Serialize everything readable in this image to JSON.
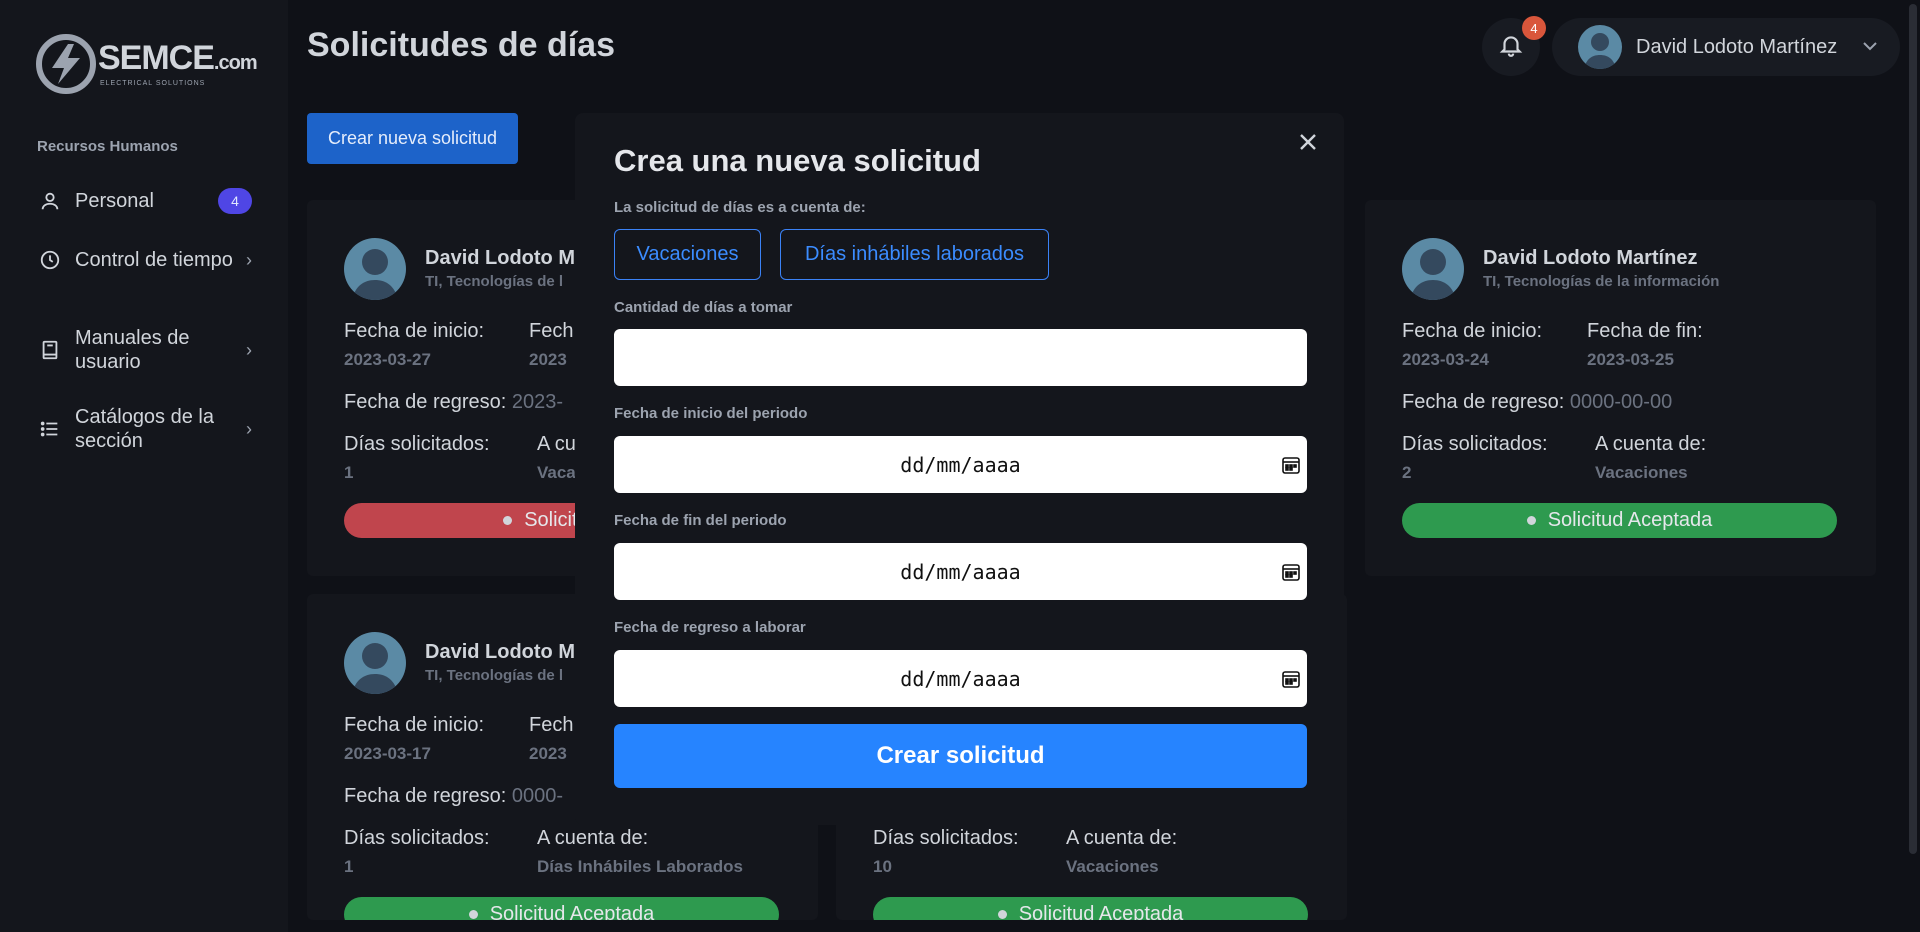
{
  "sidebar": {
    "logo": {
      "name": "SEMCE",
      "suffix": ".com",
      "tagline": "ELECTRICAL SOLUTIONS"
    },
    "section": "Recursos Humanos",
    "items": [
      {
        "label": "Personal",
        "icon": "user-icon",
        "badge": "4"
      },
      {
        "label": "Control de tiempo",
        "icon": "clock-icon"
      },
      {
        "label": "Manuales de usuario",
        "icon": "book-icon"
      },
      {
        "label": "Catálogos de la sección",
        "icon": "list-icon"
      }
    ]
  },
  "header": {
    "title": "Solicitudes de días",
    "notifications": "4",
    "user_name": "David Lodoto Martínez"
  },
  "new_request_label": "Crear nueva solicitud",
  "labels": {
    "start": "Fecha de inicio:",
    "end": "Fecha de fin:",
    "end_short": "Fech",
    "return": "Fecha de regreso:",
    "days": "Días solicitados:",
    "account": "A cuenta de:",
    "account_short": "A cu"
  },
  "cards": [
    {
      "name": "David Lodoto M",
      "dept": "TI, Tecnologías de l",
      "start": "2023-03-27",
      "end": "2023",
      "return": "2023-",
      "days": "1",
      "account": "Vaca",
      "status": "Solicitud D"
    },
    {
      "name": "David Lodoto Martínez",
      "dept": "TI, Tecnologías de la información",
      "start": "2023-03-24",
      "end": "2023-03-25",
      "return": "0000-00-00",
      "days": "2",
      "account": "Vacaciones",
      "status": "Solicitud Aceptada"
    },
    {
      "name": "David Lodoto M",
      "dept": "TI, Tecnologías de l",
      "start": "2023-03-17",
      "end": "2023",
      "return": "0000-",
      "days": "1",
      "account": "Días Inhábiles Laborados",
      "status": "Solicitud Aceptada"
    },
    {
      "days": "10",
      "account": "Vacaciones",
      "status": "Solicitud Aceptada"
    }
  ],
  "modal": {
    "title": "Crea una nueva solicitud",
    "account_label": "La solicitud de días es a cuenta de:",
    "options": [
      "Vacaciones",
      "Días inhábiles laborados"
    ],
    "qty_label": "Cantidad de días a tomar",
    "qty_value": "",
    "start_label": "Fecha de inicio del periodo",
    "end_label": "Fecha de fin del periodo",
    "return_label": "Fecha de regreso a laborar",
    "date_placeholder": "dd/mm/aaaa",
    "submit_label": "Crear solicitud"
  },
  "colors": {
    "accent": "#2684ff",
    "accepted": "#2e9a4f",
    "rejected": "#c0454d",
    "badge": "#4f46e5"
  }
}
